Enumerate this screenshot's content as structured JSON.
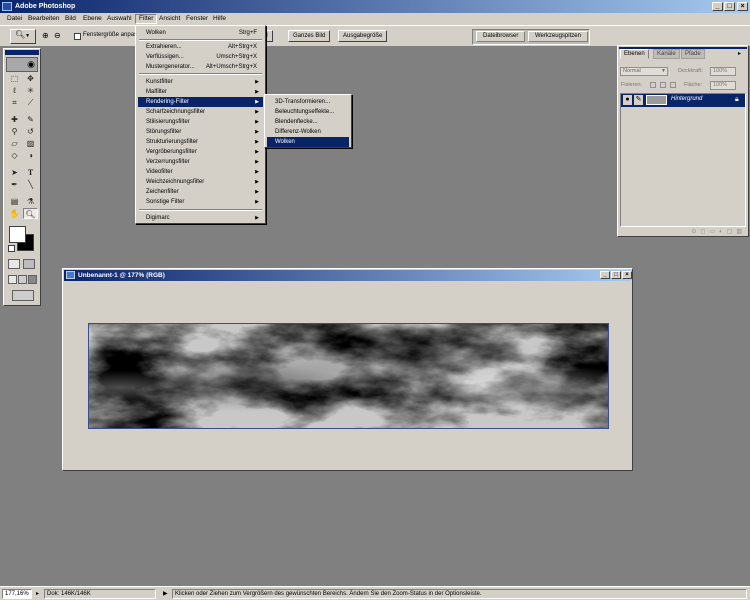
{
  "app": {
    "title": "Adobe Photoshop"
  },
  "menubar": [
    "Datei",
    "Bearbeiten",
    "Bild",
    "Ebene",
    "Auswahl",
    "Filter",
    "Ansicht",
    "Fenster",
    "Hilfe"
  ],
  "options": {
    "checkbox_label": "Fenstergröße anpassen",
    "btn_partial": "el",
    "btn_whole": "Ganzes Bild",
    "btn_print": "Ausgabegröße",
    "tab_browser": "Dateibrowser",
    "tab_presets": "Werkzeugspitzen"
  },
  "filter_menu": {
    "last": {
      "label": "Wolken",
      "shortcut": "Strg+F"
    },
    "top": [
      {
        "label": "Extrahieren...",
        "shortcut": "Alt+Strg+X"
      },
      {
        "label": "Verflüssigen...",
        "shortcut": "Umsch+Strg+X"
      },
      {
        "label": "Mustergenerator...",
        "shortcut": "Alt+Umsch+Strg+X"
      }
    ],
    "filters": [
      "Kunstfilter",
      "Malfilter",
      "Rendering-Filter",
      "Scharfzeichnungsfilter",
      "Stilisierungsfilter",
      "Störungsfilter",
      "Strukturierungsfilter",
      "Vergröberungsfilter",
      "Verzerrungsfilter",
      "Videofilter",
      "Weichzeichnungsfilter",
      "Zeichenfilter",
      "Sonstige Filter"
    ],
    "bottom": "Digimarc"
  },
  "render_submenu": [
    "3D-Transformieren...",
    "Beleuchtungseffekte...",
    "Blendenflecke...",
    "Differenz-Wolken",
    "Wolken"
  ],
  "layers_palette": {
    "tabs": [
      "Ebenen",
      "Kanäle",
      "Pfade"
    ],
    "blend_mode": "Normal",
    "opacity_label": "Deckkraft:",
    "opacity_value": "100%",
    "lock_label": "Fixieren:",
    "fill_label": "Fläche:",
    "fill_value": "100%",
    "layer_name": "Hintergrund"
  },
  "document": {
    "title": "Unbenannt-1 @ 177% (RGB)"
  },
  "status": {
    "zoom": "177,16%",
    "doc_size": "Dok: 146K/146K",
    "hint": "Klicken oder Ziehen zum Vergrößern des gewünschten Bereichs. Ändern Sie den Zoom-Status in der Optionsleiste."
  },
  "colors": {
    "accent": "#0a246a",
    "ui_face": "#d4d0c8",
    "workspace": "#808080"
  }
}
